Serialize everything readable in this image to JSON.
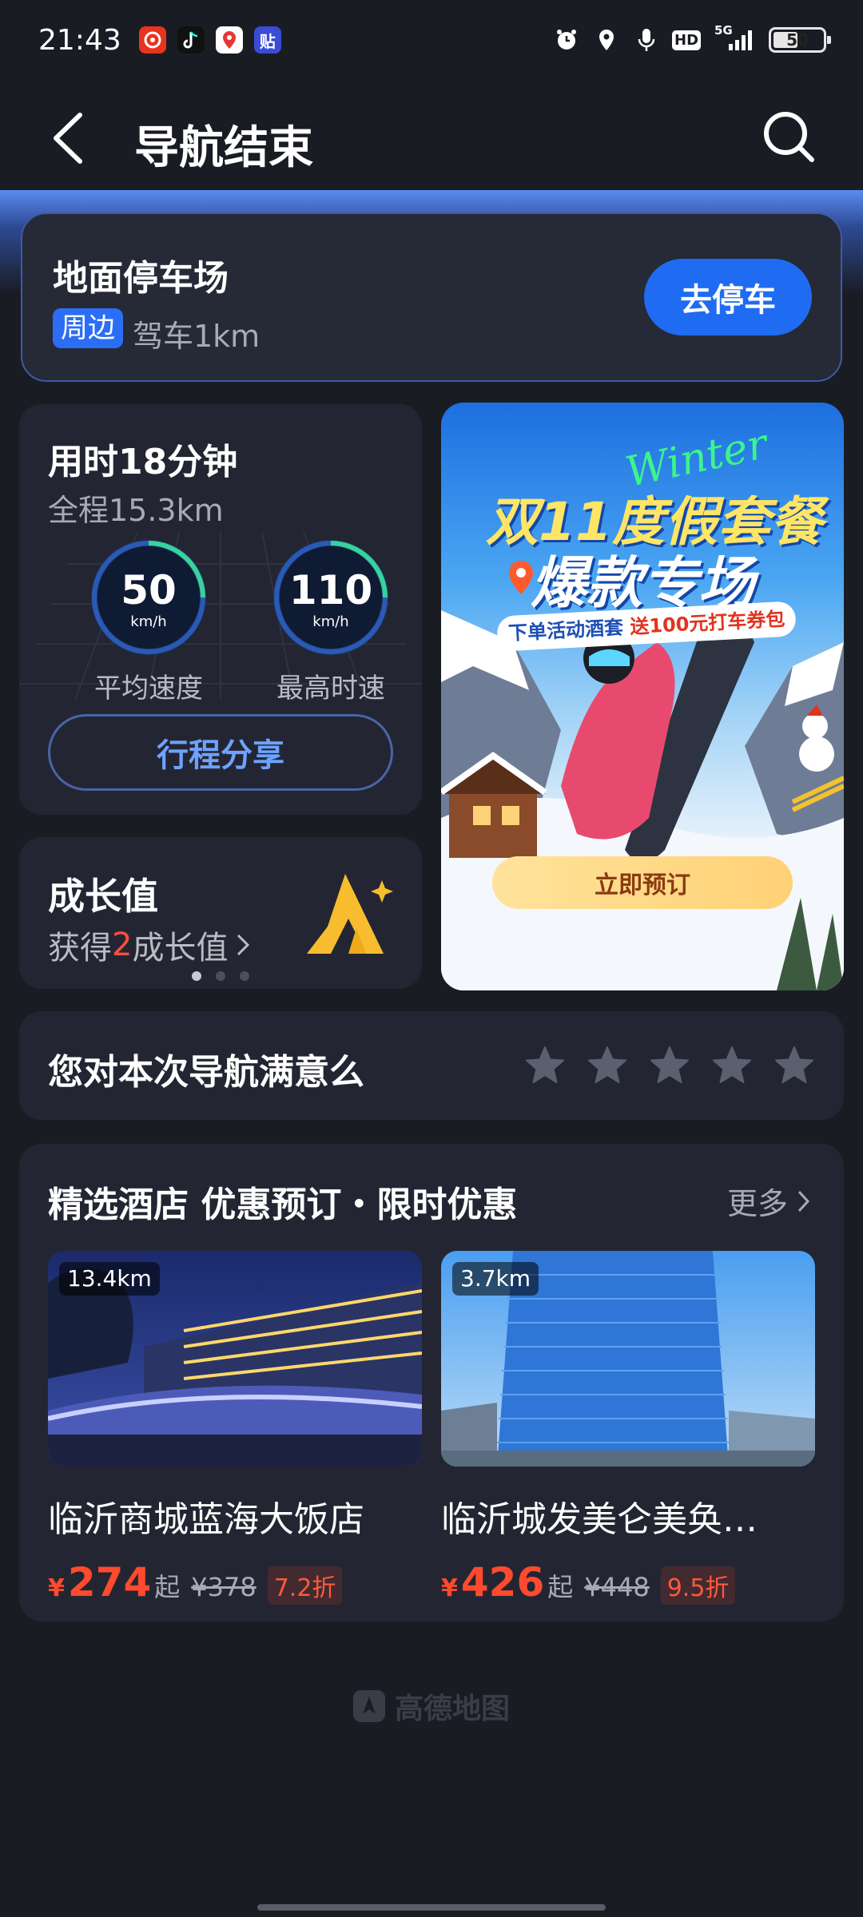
{
  "status_bar": {
    "time": "21:43",
    "app_icons": [
      "netease-music-icon",
      "tiktok-icon",
      "map-pin-app-icon",
      "tie-app-icon"
    ],
    "app_icon_texts": [
      "",
      "",
      "",
      "贴"
    ],
    "sys_icons": [
      "alarm-icon",
      "location-icon",
      "mic-icon",
      "hd-icon",
      "signal-5g-icon"
    ],
    "hd_label": "HD",
    "network_label": "5G",
    "battery_level": "50"
  },
  "header": {
    "title": "导航结束"
  },
  "parking": {
    "title": "地面停车场",
    "tag": "周边",
    "distance": "驾车1km",
    "button": "去停车"
  },
  "trip": {
    "duration": "用时18分钟",
    "distance": "全程15.3km",
    "avg_speed": "50",
    "max_speed": "110",
    "unit": "km/h",
    "avg_label": "平均速度",
    "max_label": "最高时速",
    "share_button": "行程分享"
  },
  "growth": {
    "title": "成长值",
    "prefix": "获得",
    "value": "2",
    "suffix": "成长值",
    "pager_dots": 3,
    "active_dot": 0
  },
  "promo": {
    "script_word": "Winter",
    "title_line1": "双11度假套餐",
    "title_line2": "爆款专场",
    "subtitle_a": "下单活动酒套 ",
    "subtitle_b": "送100元打车券包",
    "button": "立即预订"
  },
  "rating": {
    "question": "您对本次导航满意么",
    "stars": 5,
    "selected": 0
  },
  "hotels": {
    "title": "精选酒店 优惠预订・限时优惠",
    "more": "更多",
    "items": [
      {
        "distance": "13.4km",
        "name": "临沂商城蓝海大饭店",
        "currency": "¥",
        "price": "274",
        "price_suffix": "起",
        "original_price": "¥378",
        "discount": "7.2折"
      },
      {
        "distance": "3.7km",
        "name": "临沂城发美仑美奂…",
        "currency": "¥",
        "price": "426",
        "price_suffix": "起",
        "original_price": "¥448",
        "discount": "9.5折"
      }
    ]
  },
  "footer": {
    "brand": "高德地图"
  },
  "colors": {
    "background": "#1a1c24",
    "card": "#232632",
    "accent_blue": "#1f6bf2",
    "price_red": "#ff4a2e",
    "gauge_green": "#37d39a"
  }
}
